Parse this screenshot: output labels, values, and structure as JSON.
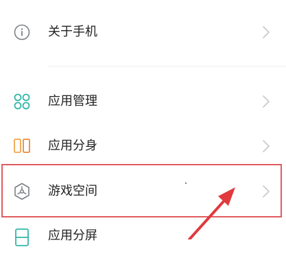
{
  "settings": {
    "items": [
      {
        "label": "关于手机",
        "icon": "info-icon"
      },
      {
        "label": "应用管理",
        "icon": "app-grid-icon"
      },
      {
        "label": "应用分身",
        "icon": "app-clone-icon"
      },
      {
        "label": "游戏空间",
        "icon": "game-space-icon"
      },
      {
        "label": "应用分屏",
        "icon": "split-screen-icon"
      }
    ]
  },
  "colors": {
    "highlight": "#e05a5e",
    "arrow": "#e03a3e",
    "icon_gray": "#7a7f86",
    "icon_teal": "#33b6a7",
    "icon_orange": "#f0a64a"
  }
}
